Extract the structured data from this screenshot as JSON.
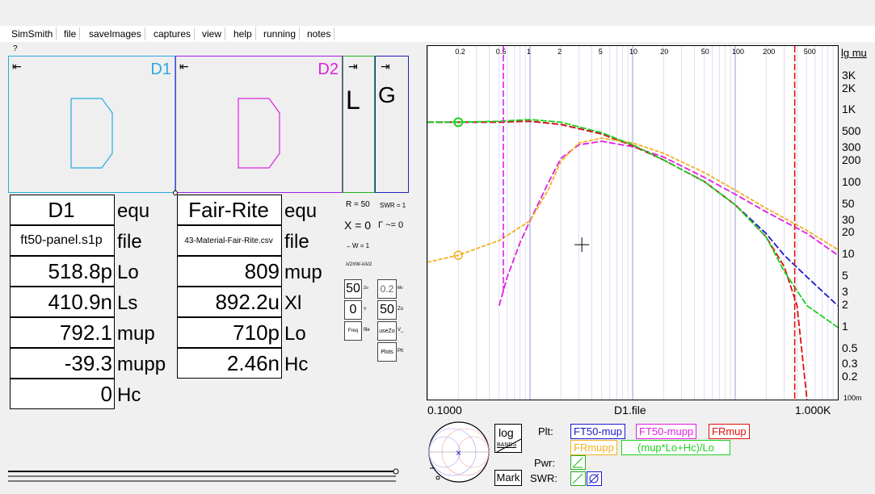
{
  "menu": [
    "SimSmith",
    "file",
    "saveImages",
    "captures",
    "view",
    "help",
    "running",
    "notes"
  ],
  "help_mark": "?",
  "blocks": {
    "d1": {
      "label": "D1",
      "color": "#29abe2"
    },
    "d2": {
      "label": "D2",
      "color": "#e020e0"
    },
    "l": {
      "label": "L",
      "color": "#20b020"
    },
    "g": {
      "label": "G",
      "color": "#2020c0"
    },
    "arrow_left": "⇤",
    "arrow_right": "⇥"
  },
  "d1_table": {
    "title": "D1",
    "title_suffix": "equ",
    "file": "ft50-panel.s1p",
    "file_suffix": "file",
    "rows": [
      {
        "value": "518.8p",
        "label": "Lo"
      },
      {
        "value": "410.9n",
        "label": "Ls"
      },
      {
        "value": "792.1",
        "label": "mup"
      },
      {
        "value": "-39.3",
        "label": "mupp"
      },
      {
        "value": "0",
        "label": "Hc"
      }
    ]
  },
  "d2_table": {
    "title": "Fair-Rite",
    "title_suffix": "equ",
    "file": "43-Material-Fair-Rite.csv",
    "file_suffix": "file",
    "rows": [
      {
        "value": "809",
        "label": "mup"
      },
      {
        "value": "892.2u",
        "label": "Xl"
      },
      {
        "value": "710p",
        "label": "Lo"
      },
      {
        "value": "2.46n",
        "label": "Hc"
      }
    ]
  },
  "gen": {
    "r": "R = 50",
    "swr": "SWR = 1",
    "x": "X = 0",
    "gamma": "Γ ~= 0",
    "w": "←W = 1",
    "wavelen": "λ/2πW-λ/λ/2",
    "box1": "50",
    "box1_lbl": "Zo",
    "box2": "0",
    "box2_lbl": "V",
    "box3": "Freq",
    "box3_lbl": "file",
    "box4": "0.2",
    "box4_lbl": "Mv",
    "box5": "50",
    "box5_lbl": "Zo",
    "box6": "useZo",
    "box6_lbl": "V_",
    "box7": "Plots",
    "box7_lbl": "Plt"
  },
  "plot": {
    "top_ticks": [
      "0.2",
      "0.5",
      "1",
      "2",
      "5",
      "10",
      "20",
      "50",
      "100",
      "200",
      "500"
    ],
    "right_ticks": [
      "3K",
      "2K",
      "1K",
      "500",
      "300",
      "200",
      "100",
      "50",
      "30",
      "20",
      "10",
      "5",
      "3",
      "2",
      "1",
      "0.5",
      "0.3",
      "0.2"
    ],
    "right_title": "lg mu",
    "right_bottom": "100m",
    "x_left": "0.1000",
    "x_mid": "D1.file",
    "x_right": "1.000K"
  },
  "chart_data": {
    "type": "line",
    "xscale": "log",
    "yscale": "log",
    "xlabel": "D1.file",
    "ylabel": "lg mu",
    "xlim": [
      0.1,
      1000
    ],
    "ylim": [
      0.1,
      5000
    ],
    "series": [
      {
        "name": "FT50-mup",
        "color": "#1a1ad0",
        "x": [
          0.1,
          0.2,
          0.5,
          1,
          2,
          5,
          10,
          20,
          50,
          100,
          200,
          300,
          500,
          1000
        ],
        "y": [
          700,
          700,
          700,
          720,
          650,
          480,
          330,
          210,
          105,
          50,
          20,
          10,
          5,
          2
        ]
      },
      {
        "name": "FT50-mupp",
        "color": "#e020e0",
        "x": [
          0.5,
          0.6,
          0.8,
          1,
          1.5,
          2,
          3,
          5,
          10,
          20,
          50,
          100,
          200,
          500,
          1000
        ],
        "y": [
          2,
          5,
          15,
          30,
          100,
          220,
          340,
          380,
          320,
          230,
          120,
          70,
          40,
          20,
          10
        ]
      },
      {
        "name": "FRmup",
        "color": "#e01010",
        "x": [
          0.1,
          0.2,
          0.5,
          1,
          2,
          5,
          10,
          20,
          50,
          100,
          200,
          300,
          400,
          500
        ],
        "y": [
          700,
          700,
          700,
          720,
          650,
          480,
          330,
          210,
          105,
          50,
          18,
          7,
          2,
          0.1
        ]
      },
      {
        "name": "FRmupp",
        "color": "#f0b020",
        "x": [
          0.1,
          0.2,
          0.5,
          1,
          1.5,
          2,
          3,
          5,
          10,
          20,
          50,
          100,
          200,
          500,
          1000
        ],
        "y": [
          8,
          10,
          16,
          30,
          80,
          200,
          360,
          420,
          360,
          260,
          140,
          80,
          45,
          22,
          12
        ]
      },
      {
        "name": "(mup*Lo+Hc)/Lo",
        "color": "#20d020",
        "x": [
          0.1,
          0.2,
          0.5,
          1,
          2,
          5,
          10,
          20,
          50,
          100,
          200,
          300,
          500,
          1000
        ],
        "y": [
          700,
          700,
          720,
          760,
          700,
          500,
          340,
          210,
          105,
          50,
          18,
          6,
          2,
          1
        ]
      }
    ]
  },
  "controls": {
    "log": "log",
    "bands": "BANDS",
    "plt": "Plt:",
    "pwr": "Pwr:",
    "mark": "Mark",
    "swr": "SWR:",
    "legend": [
      "FT50-mup",
      "FT50-mupp",
      "FRmup",
      "FRmupp",
      "(mup*Lo+Hc)/Lo"
    ],
    "colors": [
      "#1a1ad0",
      "#e020e0",
      "#e01010",
      "#f0b020",
      "#20d020"
    ]
  }
}
